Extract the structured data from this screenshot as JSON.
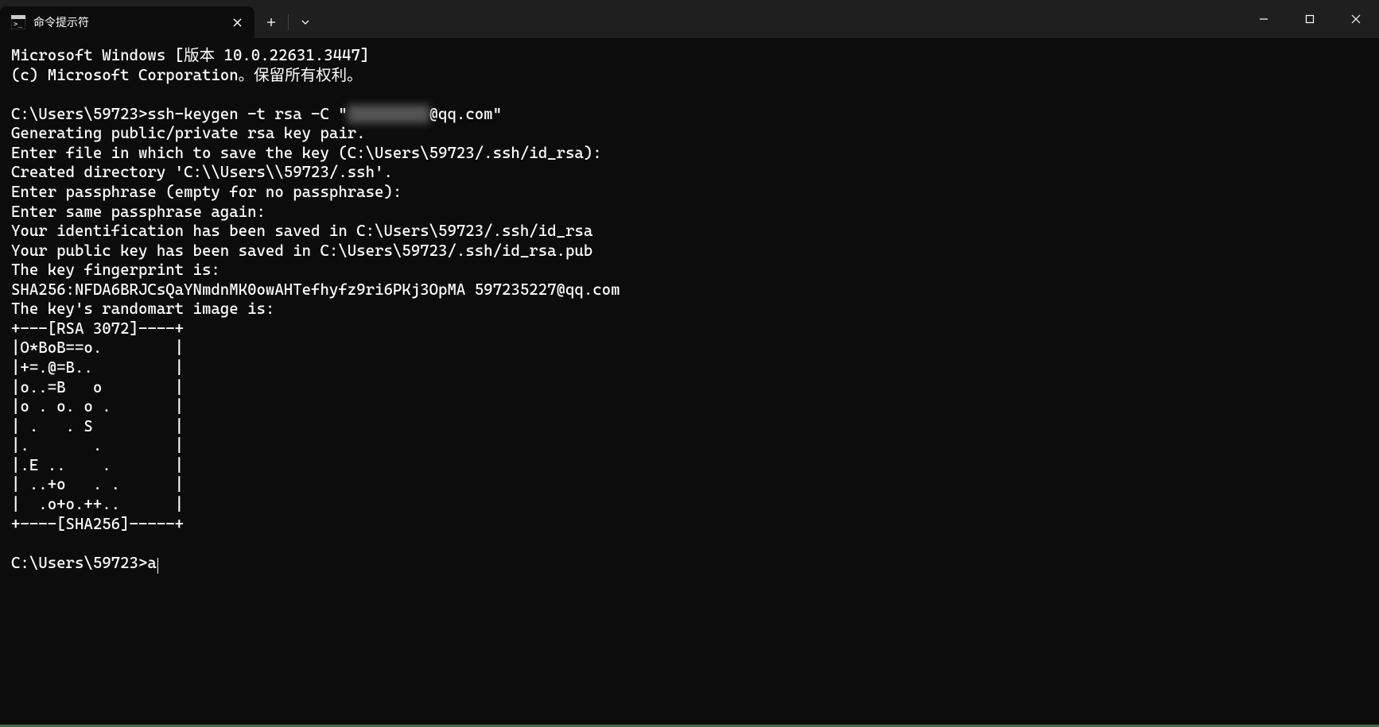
{
  "titlebar": {
    "tab_title": "命令提示符"
  },
  "terminal": {
    "lines": [
      {
        "type": "plain",
        "text": "Microsoft Windows [版本 10.0.22631.3447]"
      },
      {
        "type": "plain",
        "text": "(c) Microsoft Corporation。保留所有权利。"
      },
      {
        "type": "plain",
        "text": ""
      },
      {
        "type": "cmd_redacted",
        "prefix": "C:\\Users\\59723>ssh-keygen -t rsa -C \"",
        "redacted": "XXXXXXXXX",
        "suffix": "@qq.com\""
      },
      {
        "type": "plain",
        "text": "Generating public/private rsa key pair."
      },
      {
        "type": "plain",
        "text": "Enter file in which to save the key (C:\\Users\\59723/.ssh/id_rsa):"
      },
      {
        "type": "plain",
        "text": "Created directory 'C:\\\\Users\\\\59723/.ssh'."
      },
      {
        "type": "plain",
        "text": "Enter passphrase (empty for no passphrase):"
      },
      {
        "type": "plain",
        "text": "Enter same passphrase again:"
      },
      {
        "type": "plain",
        "text": "Your identification has been saved in C:\\Users\\59723/.ssh/id_rsa"
      },
      {
        "type": "plain",
        "text": "Your public key has been saved in C:\\Users\\59723/.ssh/id_rsa.pub"
      },
      {
        "type": "plain",
        "text": "The key fingerprint is:"
      },
      {
        "type": "plain",
        "text": "SHA256:NFDA6BRJCsQaYNmdnMK0owAHTefhyfz9ri6PKj3OpMA 597235227@qq.com"
      },
      {
        "type": "plain",
        "text": "The key's randomart image is:"
      },
      {
        "type": "plain",
        "text": "+---[RSA 3072]----+"
      },
      {
        "type": "plain",
        "text": "|O*BoB==o.        |"
      },
      {
        "type": "plain",
        "text": "|+=.@=B..         |"
      },
      {
        "type": "plain",
        "text": "|o..=B   o        |"
      },
      {
        "type": "plain",
        "text": "|o . o. o .       |"
      },
      {
        "type": "plain",
        "text": "| .   . S         |"
      },
      {
        "type": "plain",
        "text": "|.       .        |"
      },
      {
        "type": "plain",
        "text": "|.E ..    .       |"
      },
      {
        "type": "plain",
        "text": "| ..+o   . .      |"
      },
      {
        "type": "plain",
        "text": "|  .o+o.++..      |"
      },
      {
        "type": "plain",
        "text": "+----[SHA256]-----+"
      },
      {
        "type": "plain",
        "text": ""
      },
      {
        "type": "prompt_cursor",
        "prompt": "C:\\Users\\59723>",
        "input": "a"
      }
    ]
  }
}
